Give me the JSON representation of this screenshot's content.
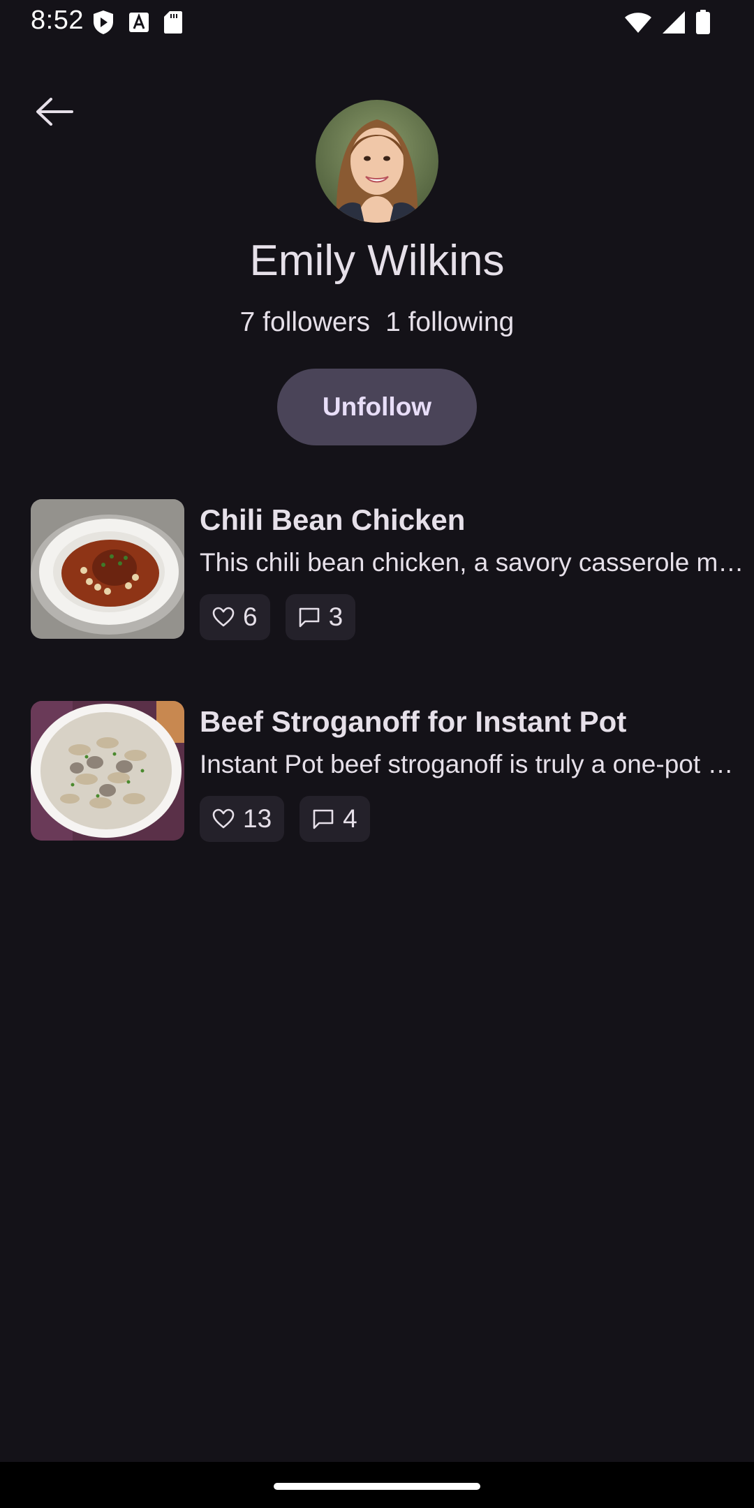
{
  "status_bar": {
    "time": "8:52",
    "left_icons": [
      "shield-play-icon",
      "font-a-icon",
      "sd-card-icon"
    ],
    "right_icons": [
      "wifi-icon",
      "signal-icon",
      "battery-icon"
    ]
  },
  "header": {
    "back_icon": "arrow-left-icon"
  },
  "profile": {
    "name": "Emily Wilkins",
    "followers": "7 followers",
    "following": "1 following",
    "unfollow_label": "Unfollow"
  },
  "recipes": [
    {
      "title": "Chili Bean Chicken",
      "description": "This chili bean chicken, a savory casserole made with chicken thighs, chili beans, and fresh peppers",
      "likes": "6",
      "comments": "3"
    },
    {
      "title": "Beef Stroganoff for Instant Pot",
      "description": "Instant Pot beef stroganoff is truly a one-pot meal with tender beef and egg noodles",
      "likes": "13",
      "comments": "4"
    }
  ],
  "colors": {
    "background": "#141218",
    "button": "#4a4458",
    "chip": "#24212a",
    "text": "#e6e0e9"
  }
}
